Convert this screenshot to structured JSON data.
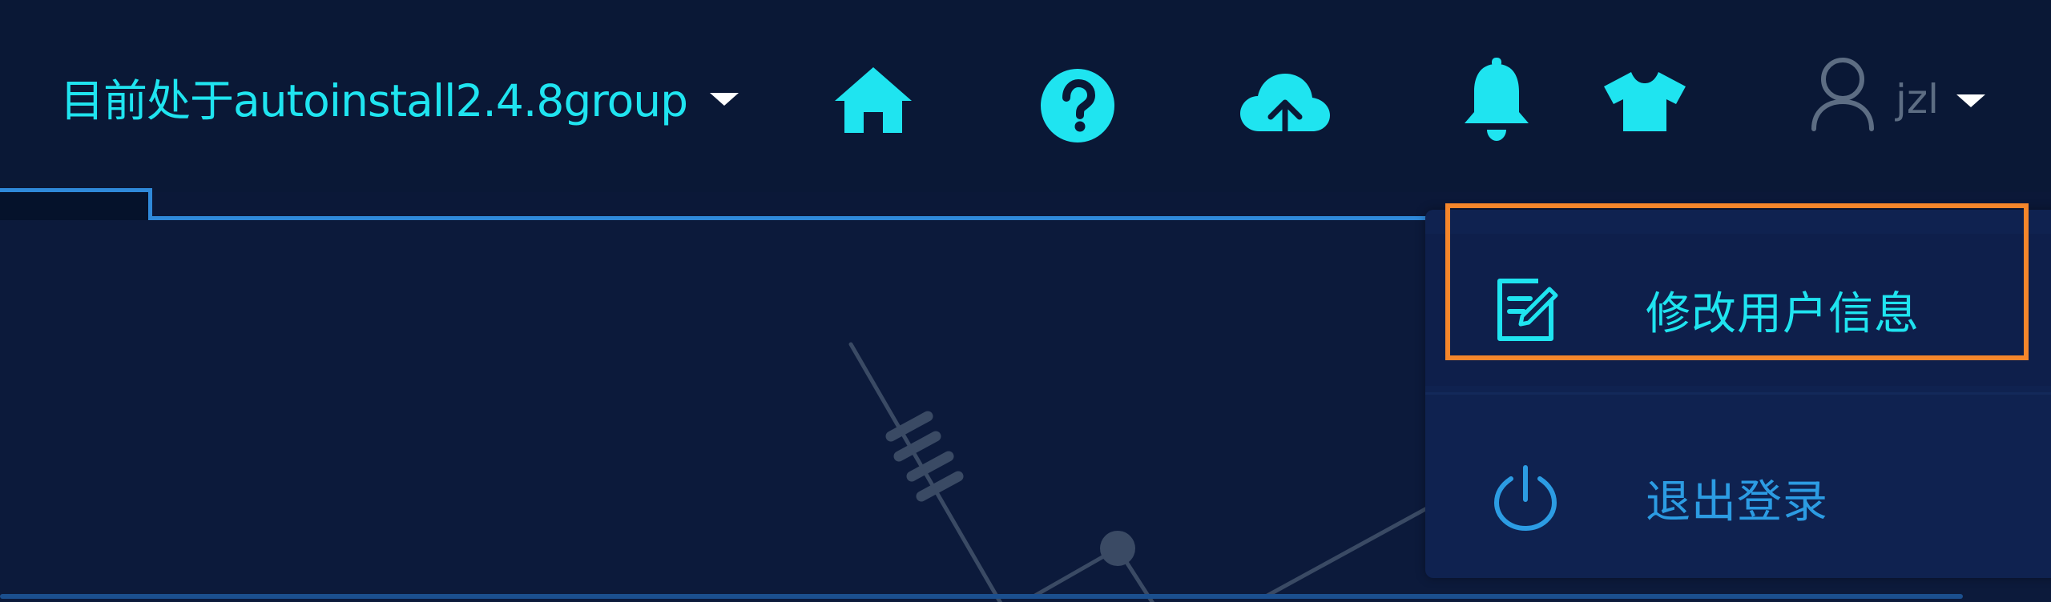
{
  "header": {
    "group_label": "目前处于autoinstall2.4.8group",
    "icons": [
      "home-icon",
      "help-icon",
      "cloud-upload-icon",
      "bell-icon",
      "tshirt-icon"
    ],
    "username": "jzl"
  },
  "user_dropdown": {
    "items": [
      {
        "label": "修改用户信息",
        "icon": "edit-icon"
      },
      {
        "label": "退出登录",
        "icon": "power-icon"
      }
    ]
  },
  "colors": {
    "accent": "#1fe4f0",
    "background": "#0a1836",
    "highlight": "#f5862b",
    "link_blue": "#2c9ce3"
  }
}
